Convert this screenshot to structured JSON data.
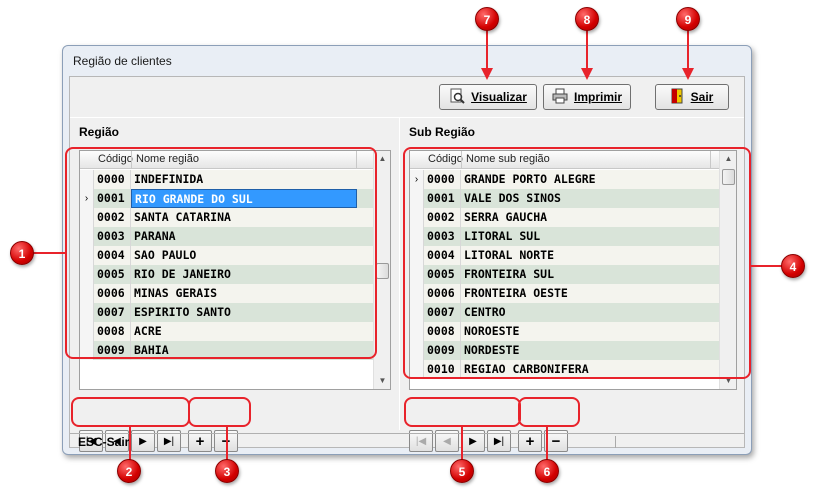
{
  "window": {
    "title": "Região de clientes"
  },
  "toolbar": {
    "visualizar": "Visualizar",
    "imprimir": "Imprimir",
    "sair": "Sair"
  },
  "regiao": {
    "label": "Região",
    "headers": {
      "code": "Código",
      "name": "Nome região"
    },
    "selected_index": 1,
    "rows": [
      {
        "code": "0000",
        "name": "INDEFINIDA"
      },
      {
        "code": "0001",
        "name": "RIO GRANDE DO SUL"
      },
      {
        "code": "0002",
        "name": "SANTA CATARINA"
      },
      {
        "code": "0003",
        "name": "PARANA"
      },
      {
        "code": "0004",
        "name": "SAO PAULO"
      },
      {
        "code": "0005",
        "name": "RIO DE JANEIRO"
      },
      {
        "code": "0006",
        "name": "MINAS GERAIS"
      },
      {
        "code": "0007",
        "name": "ESPIRITO SANTO"
      },
      {
        "code": "0008",
        "name": "ACRE"
      },
      {
        "code": "0009",
        "name": "BAHIA"
      }
    ]
  },
  "subregiao": {
    "label": "Sub Região",
    "headers": {
      "code": "Código",
      "name": "Nome sub região"
    },
    "selected_index": 0,
    "rows": [
      {
        "code": "0000",
        "name": "GRANDE PORTO ALEGRE"
      },
      {
        "code": "0001",
        "name": "VALE DOS SINOS"
      },
      {
        "code": "0002",
        "name": "SERRA GAUCHA"
      },
      {
        "code": "0003",
        "name": "LITORAL SUL"
      },
      {
        "code": "0004",
        "name": "LITORAL NORTE"
      },
      {
        "code": "0005",
        "name": "FRONTEIRA SUL"
      },
      {
        "code": "0006",
        "name": "FRONTEIRA OESTE"
      },
      {
        "code": "0007",
        "name": "CENTRO"
      },
      {
        "code": "0008",
        "name": "NOROESTE"
      },
      {
        "code": "0009",
        "name": "NORDESTE"
      },
      {
        "code": "0010",
        "name": "REGIAO CARBONIFERA"
      }
    ]
  },
  "statusbar": {
    "text": "ESC-Sair"
  },
  "annotations": [
    "1",
    "2",
    "3",
    "4",
    "5",
    "6",
    "7",
    "8",
    "9"
  ],
  "colors": {
    "selection": "#3399ff",
    "row_odd": "#d9e4d9",
    "annotation": "#e8232b"
  }
}
